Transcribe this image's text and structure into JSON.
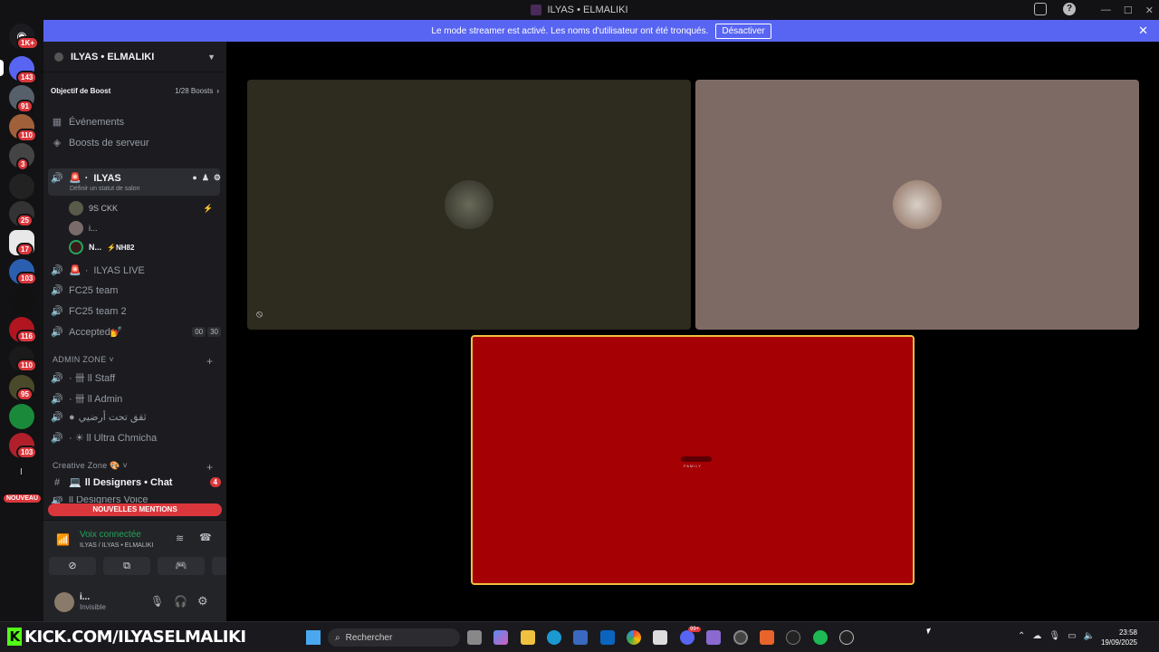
{
  "window": {
    "title": "ILYAS • ELMALIKI"
  },
  "banner": {
    "text": "Le mode streamer est activé. Les noms d'utilisateur ont été tronqués.",
    "button": "Désactiver"
  },
  "guilds": {
    "badges": [
      "1K+",
      "143",
      "91",
      "110",
      "3",
      "25",
      "17",
      "103",
      "116",
      "110",
      "95",
      "103"
    ],
    "new_label": "NOUVEAU"
  },
  "server": {
    "name": "ILYAS • ELMALIKI",
    "boost_label": "Objectif de Boost",
    "boost_count": "1/28 Boosts"
  },
  "nav": {
    "events": "Événements",
    "boosts": "Boosts de serveur"
  },
  "voice_channel": {
    "name": "ILYAS",
    "status": "Définir un statut de salon",
    "prefix": "·"
  },
  "users": [
    {
      "name": "9S CKK"
    },
    {
      "name": "i..."
    },
    {
      "name": "N...",
      "tag": "⚡NH82"
    }
  ],
  "channels": [
    {
      "name": "ILYAS LIVE"
    },
    {
      "name": "FC25 team"
    },
    {
      "name": "FC25 team 2"
    },
    {
      "name": "Accepted💅",
      "count1": "00",
      "count2": "30"
    }
  ],
  "admin_zone": {
    "label": "ADMIN ZONE",
    "channels": [
      "· 卌 ll Staff",
      "· 卌 ll Admin",
      "ثقق تحت أرضيي",
      "· ☀ ll Ultra Chmicha"
    ]
  },
  "creative_zone": {
    "label": "Creative Zone 🎨",
    "channels": [
      {
        "name": "ll Designers • Chat",
        "badge": "4"
      },
      {
        "name": "ll Designers Voice"
      }
    ]
  },
  "new_mentions": "NOUVELLES MENTIONS",
  "voice_panel": {
    "title": "Voix connectée",
    "subtitle": "ILYAS / ILYAS • ELMALIKI"
  },
  "user_panel": {
    "name": "i...",
    "status": "Invisible"
  },
  "tiles": [
    {
      "bg": "#2e2b1f"
    },
    {
      "bg": "#7e6a65"
    },
    {
      "bg": "#a50004"
    }
  ],
  "stream_label": "FAMILY",
  "taskbar": {
    "kick": "KICK.COM/ILYASELMALIKI",
    "search": "Rechercher",
    "time": "23:58",
    "date": "19/09/2025",
    "badge": "99+"
  }
}
